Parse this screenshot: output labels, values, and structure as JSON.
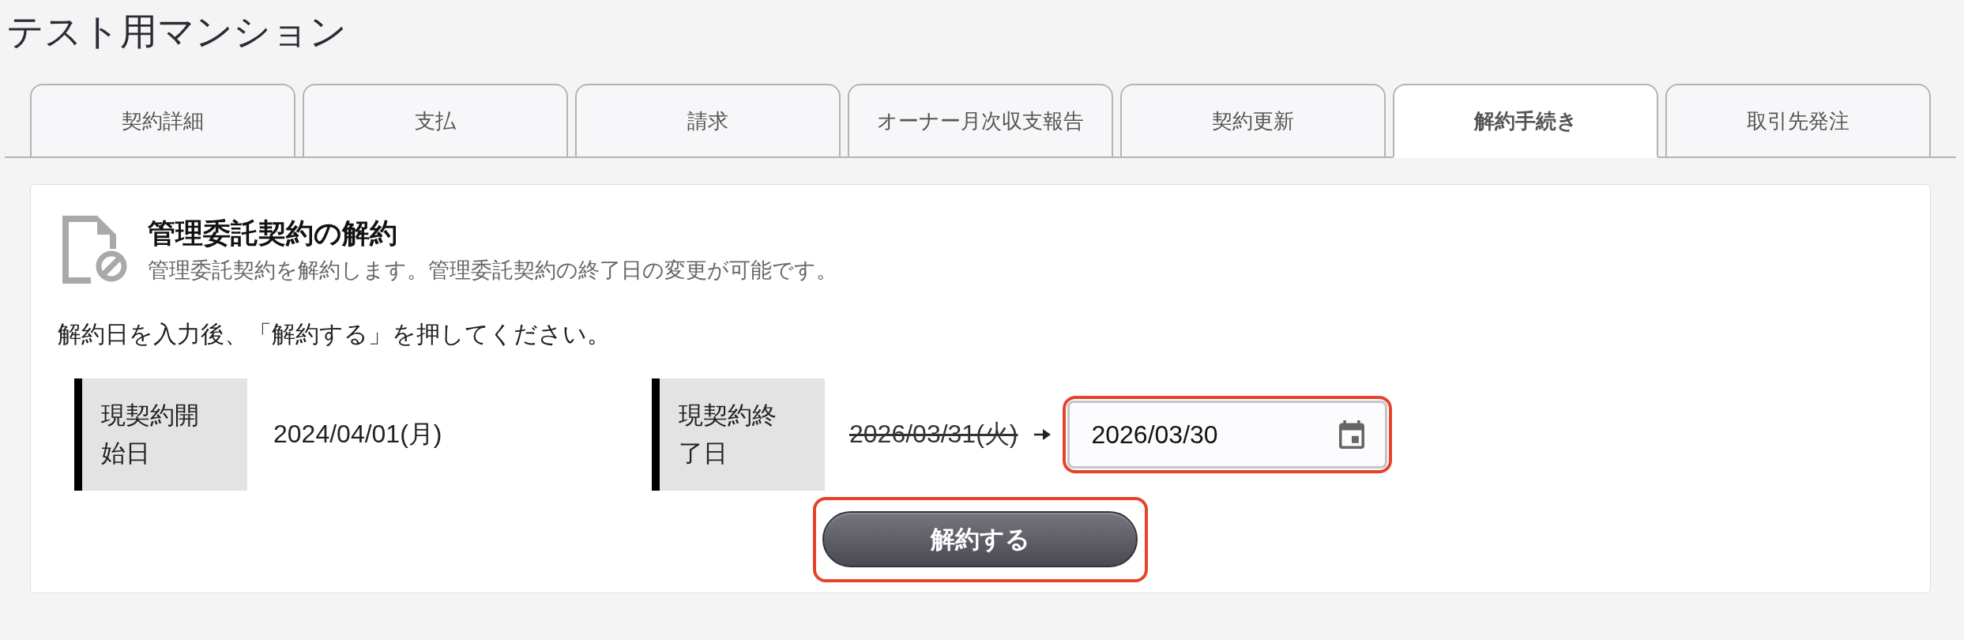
{
  "page": {
    "title": "テスト用マンション"
  },
  "tabs": [
    {
      "label": "契約詳細",
      "selected": false
    },
    {
      "label": "支払",
      "selected": false
    },
    {
      "label": "請求",
      "selected": false
    },
    {
      "label": "オーナー月次収支報告",
      "selected": false
    },
    {
      "label": "契約更新",
      "selected": false
    },
    {
      "label": "解約手続き",
      "selected": true
    },
    {
      "label": "取引先発注",
      "selected": false
    }
  ],
  "panel": {
    "title": "管理委託契約の解約",
    "description": "管理委託契約を解約します。管理委託契約の終了日の変更が可能です。",
    "instruction": "解約日を入力後、「解約する」を押してください。",
    "fields": [
      {
        "kind": "text",
        "label": "現契約開始日",
        "value": "2024/04/01(月)"
      },
      {
        "kind": "date_change",
        "label": "現契約終了日",
        "old_value": "2026/03/31(火)",
        "new_value": "2026/03/30",
        "highlighted": true
      }
    ],
    "submit_button": {
      "label": "解約する",
      "highlighted": true
    }
  }
}
